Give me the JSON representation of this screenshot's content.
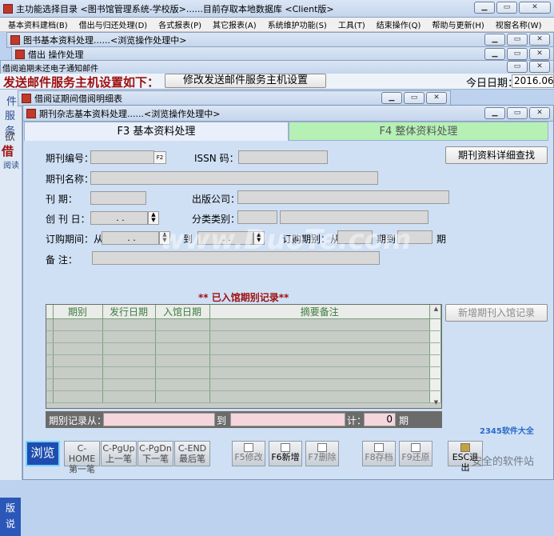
{
  "main_window": {
    "title": "主功能选择目录 <图书馆管理系统-学校版>......目前存取本地数据库 <Client版>"
  },
  "menu": [
    "基本资料建档(B)",
    "借出与归还处理(D)",
    "各式报表(P)",
    "其它报表(A)",
    "系统维护功能(S)",
    "工具(T)",
    "结束操作(Q)",
    "帮助与更新(H)",
    "视窗名称(W)"
  ],
  "bg_window_1": {
    "title": "图书基本资料处理......<浏览操作处理中>"
  },
  "bg_window_2": {
    "title": "借出 操作处理"
  },
  "bg_window_3": {
    "title": "借阅逾期未还电子通知邮件"
  },
  "mail_banner": {
    "text": "发送邮件服务主机设置如下：",
    "button": "修改发送邮件服务主机设置",
    "date_label": "今日日期：",
    "date_value": "2016.06."
  },
  "bg_window_4": {
    "title": "借阅证期间借阅明细表"
  },
  "bg_left_fragments": [
    "件",
    "服务",
    "欲",
    "借",
    "阅读",
    "版",
    "说"
  ],
  "form_window": {
    "title": "期刊杂志基本资料处理......<浏览操作处理中>"
  },
  "tabs": {
    "active": "F3 基本资料处理",
    "inactive": "F4 整体资料处理"
  },
  "fields": {
    "periodical_no_label": "期刊编号：",
    "f2_hint": "F2",
    "issn_label": "ISSN 码：",
    "name_label": "期刊名称：",
    "period_label": "刊    期：",
    "publisher_label": "出版公司：",
    "founded_label": "创 刊 日：",
    "founded_value": " .  . ",
    "category_label": "分类类别：",
    "sub_from_label": "订购期间：从",
    "sub_from_value": " .  . ",
    "sub_to_label": "到",
    "sub_to_value": " .  . ",
    "issue_from_label": "订购期别：从",
    "issue_to_label": "期到",
    "issue_suffix": "期",
    "remark_label": "备    注："
  },
  "detail_search_button": "期刊资料详细查找",
  "records_title": "** 已入馆期别记录**",
  "grid_columns": [
    "期别",
    "发行日期",
    "入馆日期",
    "摘要备注"
  ],
  "add_issue_button": "新增期刊入馆记录",
  "summary": {
    "from_label": "期别记录从：",
    "to_label": "到",
    "total_label": "计：",
    "total_value": "0",
    "unit": "期"
  },
  "nav": {
    "browse": "浏览",
    "first": [
      "C-HOME",
      "第一笔"
    ],
    "prev": [
      "C-PgUp",
      "上一笔"
    ],
    "next": [
      "C-PgDn",
      "下一笔"
    ],
    "last": [
      "C-END",
      "最后笔"
    ],
    "edit": "F5修改",
    "add": "F6新增",
    "delete": "F7删除",
    "save": "F8存档",
    "restore": "F9还原",
    "exit": "ESC退出"
  },
  "watermark": {
    "site": "www.DuoTe.com",
    "brand": "2345软件大全",
    "slogan": "安全的软件站"
  },
  "colors": {
    "desktop": "#bcd2ee",
    "panel": "#cfe0f5",
    "active_tab": "#e9f0fb",
    "inactive_tab": "#b5f0b5",
    "banner_text": "#a01010",
    "record_title": "#a01010"
  }
}
